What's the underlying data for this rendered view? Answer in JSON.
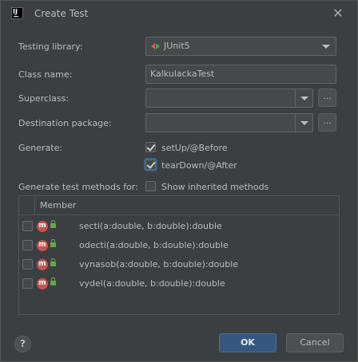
{
  "window": {
    "title": "Create Test",
    "close": "✕"
  },
  "form": {
    "testing_library_label": "Testing library:",
    "testing_library_value": "JUnit5",
    "class_name_label": "Class name:",
    "class_name_value": "KalkulackaTest",
    "superclass_label": "Superclass:",
    "superclass_value": "",
    "destination_package_label": "Destination package:",
    "destination_package_value": "",
    "browse_label": "...",
    "generate_label": "Generate:",
    "setup_label": "setUp/@Before",
    "setup_checked": true,
    "teardown_label": "tearDown/@After",
    "teardown_checked": true,
    "generate_methods_label": "Generate test methods for:",
    "show_inherited_label": "Show inherited methods",
    "show_inherited_checked": false
  },
  "table": {
    "header": "Member",
    "icon_letter": "m",
    "rows": [
      {
        "method": "secti(a:double, b:double):double",
        "checked": false
      },
      {
        "method": "odecti(a:double, b:double):double",
        "checked": false
      },
      {
        "method": "vynasob(a:double, b:double):double",
        "checked": false
      },
      {
        "method": "vydel(a:double, b:double):double",
        "checked": false
      }
    ]
  },
  "footer": {
    "help": "?",
    "ok": "OK",
    "cancel": "Cancel"
  },
  "colors": {
    "background": "#3c3f41",
    "ok_button": "#365880",
    "method_icon": "#c75450",
    "lock_icon": "#62a84b"
  }
}
